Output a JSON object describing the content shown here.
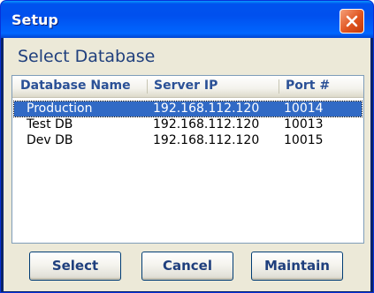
{
  "window": {
    "title": "Setup"
  },
  "heading": "Select Database",
  "table": {
    "columns": [
      "Database Name",
      "Server IP",
      "Port #"
    ],
    "rows": [
      {
        "name": "Production",
        "ip": "192.168.112.120",
        "port": "10014",
        "selected": true
      },
      {
        "name": "Test DB",
        "ip": "192.168.112.120",
        "port": "10013",
        "selected": false
      },
      {
        "name": "Dev DB",
        "ip": "192.168.112.120",
        "port": "10015",
        "selected": false
      }
    ]
  },
  "buttons": {
    "select": "Select",
    "cancel": "Cancel",
    "maintain": "Maintain"
  },
  "colors": {
    "title_bar": "#0058ee",
    "selection": "#316ac5",
    "heading_text": "#1f3f7d",
    "dialog_bg": "#ece9d8"
  },
  "icons": {
    "close": "close-icon"
  }
}
